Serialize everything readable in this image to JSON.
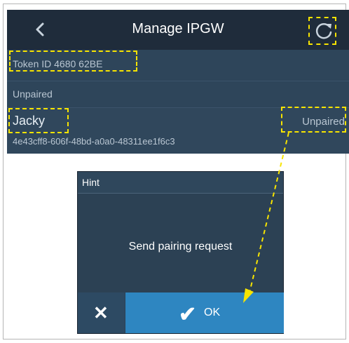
{
  "nav": {
    "title": "Manage IPGW",
    "back_icon": "chevron-left-icon",
    "refresh_icon": "refresh-icon"
  },
  "token": {
    "label": "Token ID 4680 62BE"
  },
  "section": {
    "label": "Unpaired"
  },
  "device": {
    "name": "Jacky",
    "uuid": "4e43cff8-606f-48bd-a0a0-48311ee1f6c3",
    "status": "Unpaired"
  },
  "dialog": {
    "title": "Hint",
    "message": "Send pairing request",
    "cancel_icon": "close-icon",
    "ok_icon": "check-icon",
    "ok_label": "OK"
  },
  "colors": {
    "nav_bg": "#1f2c3b",
    "panel_bg": "#2c4154",
    "ok_blue": "#2e86c1",
    "highlight": "#f7e400"
  }
}
